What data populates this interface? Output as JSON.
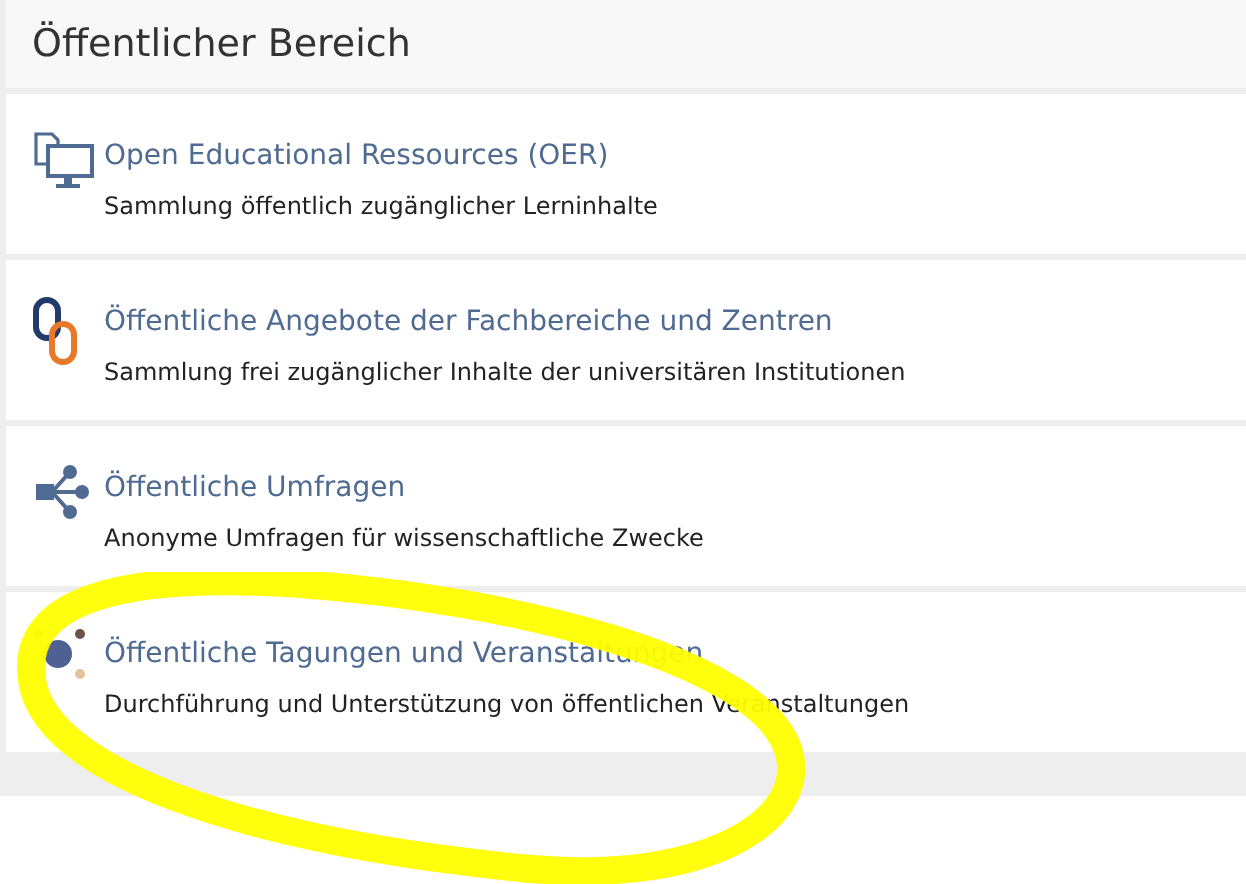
{
  "panel": {
    "title": "Öffentlicher Bereich"
  },
  "items": [
    {
      "kind": "documents",
      "title": "Open Educational Ressources (OER)",
      "description": "Sammlung öffentlich zugänglicher Lerninhalte"
    },
    {
      "kind": "chain",
      "title": "Öffentliche Angebote der Fachbereiche und Zentren",
      "description": "Sammlung frei zugänglicher Inhalte der universitären Institutionen"
    },
    {
      "kind": "share",
      "title": "Öffentliche Umfragen",
      "description": "Anonyme Umfragen für wissenschaftliche Zwecke"
    },
    {
      "kind": "dots",
      "title": "Öffentliche Tagungen und Veranstaltungen",
      "description": "Durchführung und Unterstützung von öffentlichen Veranstaltungen"
    }
  ]
}
